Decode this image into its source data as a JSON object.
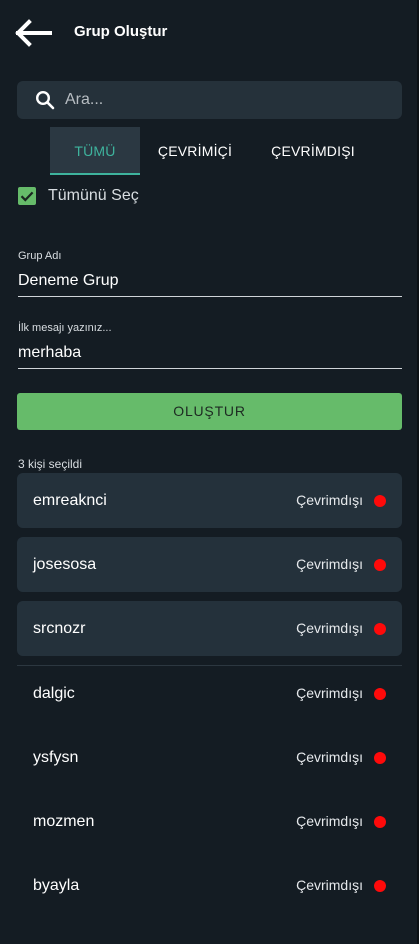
{
  "header": {
    "title": "Grup Oluştur"
  },
  "search": {
    "placeholder": "Ara..."
  },
  "tabs": [
    {
      "label": "TÜMÜ",
      "active": true
    },
    {
      "label": "ÇEVRİMİÇİ",
      "active": false
    },
    {
      "label": "ÇEVRİMDIŞI",
      "active": false
    }
  ],
  "select_all": {
    "label": "Tümünü Seç",
    "checked": true
  },
  "group_name": {
    "label": "Grup Adı",
    "value": "Deneme Grup"
  },
  "first_message": {
    "label": "İlk mesajı yazınız...",
    "value": "merhaba"
  },
  "create_button": {
    "label": "OLUŞTUR"
  },
  "selected_count": "3 kişi seçildi",
  "selected_users": [
    {
      "name": "emreaknci",
      "status": "Çevrimdışı"
    },
    {
      "name": "josesosa",
      "status": "Çevrimdışı"
    },
    {
      "name": "srcnozr",
      "status": "Çevrimdışı"
    }
  ],
  "users": [
    {
      "name": "dalgic",
      "status": "Çevrimdışı"
    },
    {
      "name": "ysfysn",
      "status": "Çevrimdışı"
    },
    {
      "name": "mozmen",
      "status": "Çevrimdışı"
    },
    {
      "name": "byayla",
      "status": "Çevrimdışı"
    }
  ],
  "colors": {
    "background": "#141c23",
    "accent_green": "#66bb6a",
    "tab_active": "#3eb39d",
    "offline_dot": "#ff0a0a"
  }
}
